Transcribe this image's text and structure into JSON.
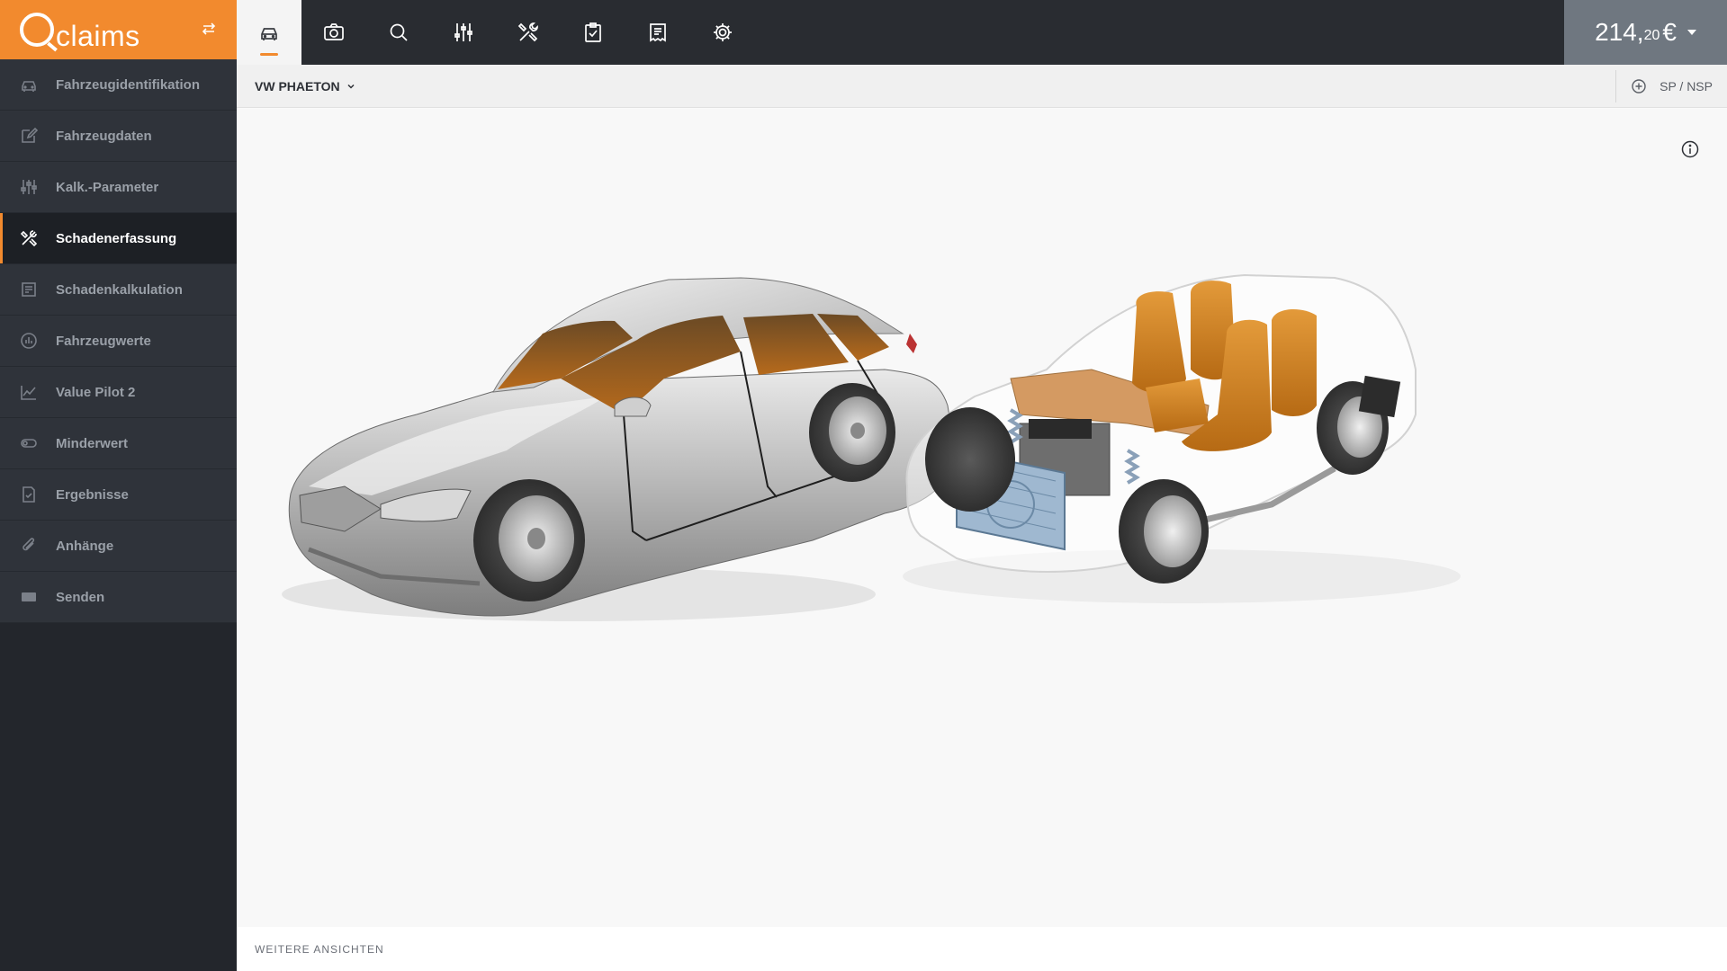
{
  "brand": {
    "name": "claims"
  },
  "sidebar": {
    "items": [
      {
        "label": "Fahrzeugidentifikation",
        "icon": "car-icon",
        "active": false
      },
      {
        "label": "Fahrzeugdaten",
        "icon": "edit-icon",
        "active": false
      },
      {
        "label": "Kalk.-Parameter",
        "icon": "sliders-icon",
        "active": false
      },
      {
        "label": "Schadenerfassung",
        "icon": "tools-icon",
        "active": true
      },
      {
        "label": "Schadenkalkulation",
        "icon": "calculation-icon",
        "active": false
      },
      {
        "label": "Fahrzeugwerte",
        "icon": "gauge-icon",
        "active": false
      },
      {
        "label": "Value Pilot 2",
        "icon": "line-chart-icon",
        "active": false
      },
      {
        "label": "Minderwert",
        "icon": "depreciation-icon",
        "active": false
      },
      {
        "label": "Ergebnisse",
        "icon": "results-icon",
        "active": false
      },
      {
        "label": "Anhänge",
        "icon": "paperclip-icon",
        "active": false
      },
      {
        "label": "Senden",
        "icon": "send-icon",
        "active": false
      }
    ]
  },
  "toolbar": {
    "tools": [
      "car-icon",
      "camera-icon",
      "search-icon",
      "sliders-icon",
      "tools-icon",
      "clipboard-check-icon",
      "receipt-icon",
      "gear-icon"
    ],
    "active_tool": "car-icon"
  },
  "price": {
    "main": "214,",
    "cents": "20",
    "currency": "€"
  },
  "subheader": {
    "vehicle": "VW PHAETON",
    "spnsp": "SP / NSP"
  },
  "footer": {
    "label": "WEITERE ANSICHTEN"
  },
  "colors": {
    "accent": "#f28a2e",
    "sidebar_bg": "#2f333a",
    "topbar_bg": "#292c31",
    "price_bg": "#6f7780"
  }
}
